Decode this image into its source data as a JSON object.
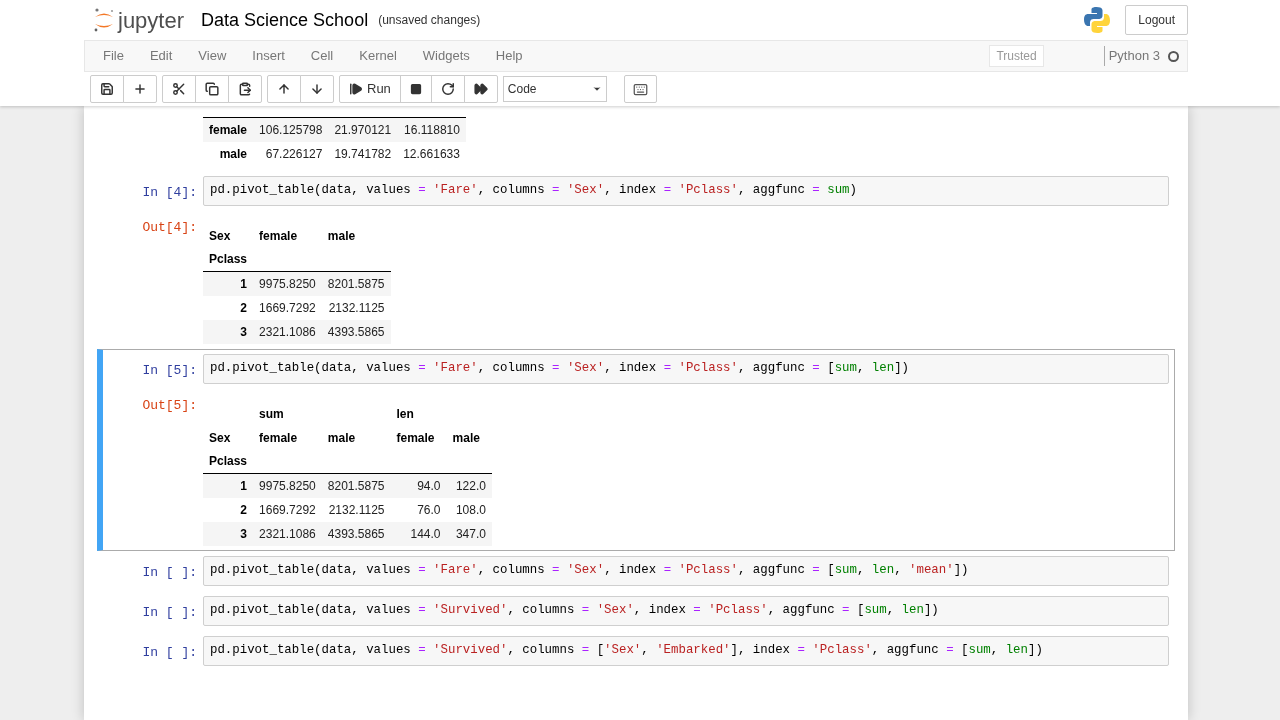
{
  "header": {
    "logo_text": "jupyter",
    "notebook_title": "Data Science School",
    "save_status": "(unsaved changes)",
    "logout": "Logout"
  },
  "menu": {
    "items": [
      "File",
      "Edit",
      "View",
      "Insert",
      "Cell",
      "Kernel",
      "Widgets",
      "Help"
    ],
    "trusted": "Trusted",
    "kernel": "Python 3"
  },
  "toolbar": {
    "groups": [
      [
        {
          "kind": "save"
        },
        {
          "kind": "add"
        }
      ],
      [
        {
          "kind": "cut"
        },
        {
          "kind": "copy"
        },
        {
          "kind": "paste"
        }
      ],
      [
        {
          "kind": "up"
        },
        {
          "kind": "down"
        }
      ],
      [
        {
          "kind": "run",
          "label": "Run"
        },
        {
          "kind": "stop"
        },
        {
          "kind": "restart"
        },
        {
          "kind": "fastforward"
        }
      ]
    ],
    "cell_type": "Code"
  },
  "cells": [
    {
      "selected": false,
      "output": {
        "table": {
          "rows": [
            {
              "index": "female",
              "values": [
                "106.125798",
                "21.970121",
                "16.118810"
              ]
            },
            {
              "index": "male",
              "values": [
                "67.226127",
                "19.741782",
                "12.661633"
              ]
            }
          ]
        }
      }
    },
    {
      "selected": false,
      "prompt_in": "In [4]:",
      "code": [
        {
          "kind": "plain",
          "text": "pd.pivot_table(data, values "
        },
        {
          "kind": "op",
          "text": "="
        },
        {
          "kind": "str",
          "text": " 'Fare'"
        },
        {
          "kind": "plain",
          "text": ", columns "
        },
        {
          "kind": "op",
          "text": "="
        },
        {
          "kind": "str",
          "text": " 'Sex'"
        },
        {
          "kind": "plain",
          "text": ", index "
        },
        {
          "kind": "op",
          "text": "="
        },
        {
          "kind": "str",
          "text": " 'Pclass'"
        },
        {
          "kind": "plain",
          "text": ", aggfunc "
        },
        {
          "kind": "op",
          "text": "="
        },
        {
          "kind": "builtin",
          "text": " sum"
        },
        {
          "kind": "plain",
          "text": ")"
        }
      ],
      "prompt_out": "Out[4]:",
      "output": {
        "table": {
          "header_rows": [
            [
              "Sex",
              "female",
              "male"
            ]
          ],
          "index_header": "Pclass",
          "rows": [
            {
              "index": "1",
              "values": [
                "9975.8250",
                "8201.5875"
              ]
            },
            {
              "index": "2",
              "values": [
                "1669.7292",
                "2132.1125"
              ]
            },
            {
              "index": "3",
              "values": [
                "2321.1086",
                "4393.5865"
              ]
            }
          ]
        }
      }
    },
    {
      "selected": true,
      "prompt_in": "In [5]:",
      "code": [
        {
          "kind": "plain",
          "text": "pd.pivot_table(data, values "
        },
        {
          "kind": "op",
          "text": "="
        },
        {
          "kind": "str",
          "text": " 'Fare'"
        },
        {
          "kind": "plain",
          "text": ", columns "
        },
        {
          "kind": "op",
          "text": "="
        },
        {
          "kind": "str",
          "text": " 'Sex'"
        },
        {
          "kind": "plain",
          "text": ", index "
        },
        {
          "kind": "op",
          "text": "="
        },
        {
          "kind": "str",
          "text": " 'Pclass'"
        },
        {
          "kind": "plain",
          "text": ", aggfunc "
        },
        {
          "kind": "op",
          "text": "="
        },
        {
          "kind": "plain",
          "text": " ["
        },
        {
          "kind": "builtin",
          "text": "sum"
        },
        {
          "kind": "plain",
          "text": ", "
        },
        {
          "kind": "builtin",
          "text": "len"
        },
        {
          "kind": "plain",
          "text": "])"
        }
      ],
      "prompt_out": "Out[5]:",
      "output": {
        "table": {
          "header_rows": [
            [
              null,
              "sum",
              null,
              "len",
              null
            ],
            [
              "Sex",
              "female",
              "male",
              "female",
              "male"
            ]
          ],
          "index_header": "Pclass",
          "rows": [
            {
              "index": "1",
              "values": [
                "9975.8250",
                "8201.5875",
                "94.0",
                "122.0"
              ]
            },
            {
              "index": "2",
              "values": [
                "1669.7292",
                "2132.1125",
                "76.0",
                "108.0"
              ]
            },
            {
              "index": "3",
              "values": [
                "2321.1086",
                "4393.5865",
                "144.0",
                "347.0"
              ]
            }
          ]
        }
      }
    },
    {
      "selected": false,
      "prompt_in": "In [ ]:",
      "code": [
        {
          "kind": "plain",
          "text": "pd.pivot_table(data, values "
        },
        {
          "kind": "op",
          "text": "="
        },
        {
          "kind": "str",
          "text": " 'Fare'"
        },
        {
          "kind": "plain",
          "text": ", columns "
        },
        {
          "kind": "op",
          "text": "="
        },
        {
          "kind": "str",
          "text": " 'Sex'"
        },
        {
          "kind": "plain",
          "text": ", index "
        },
        {
          "kind": "op",
          "text": "="
        },
        {
          "kind": "str",
          "text": " 'Pclass'"
        },
        {
          "kind": "plain",
          "text": ", aggfunc "
        },
        {
          "kind": "op",
          "text": "="
        },
        {
          "kind": "plain",
          "text": " ["
        },
        {
          "kind": "builtin",
          "text": "sum"
        },
        {
          "kind": "plain",
          "text": ", "
        },
        {
          "kind": "builtin",
          "text": "len"
        },
        {
          "kind": "plain",
          "text": ", "
        },
        {
          "kind": "str",
          "text": "'mean'"
        },
        {
          "kind": "plain",
          "text": "])"
        }
      ]
    },
    {
      "selected": false,
      "prompt_in": "In [ ]:",
      "code": [
        {
          "kind": "plain",
          "text": "pd.pivot_table(data, values "
        },
        {
          "kind": "op",
          "text": "="
        },
        {
          "kind": "str",
          "text": " 'Survived'"
        },
        {
          "kind": "plain",
          "text": ", columns "
        },
        {
          "kind": "op",
          "text": "="
        },
        {
          "kind": "str",
          "text": " 'Sex'"
        },
        {
          "kind": "plain",
          "text": ", index "
        },
        {
          "kind": "op",
          "text": "="
        },
        {
          "kind": "str",
          "text": " 'Pclass'"
        },
        {
          "kind": "plain",
          "text": ", aggfunc "
        },
        {
          "kind": "op",
          "text": "="
        },
        {
          "kind": "plain",
          "text": " ["
        },
        {
          "kind": "builtin",
          "text": "sum"
        },
        {
          "kind": "plain",
          "text": ", "
        },
        {
          "kind": "builtin",
          "text": "len"
        },
        {
          "kind": "plain",
          "text": "])"
        }
      ]
    },
    {
      "selected": false,
      "prompt_in": "In [ ]:",
      "code": [
        {
          "kind": "plain",
          "text": "pd.pivot_table(data, values "
        },
        {
          "kind": "op",
          "text": "="
        },
        {
          "kind": "str",
          "text": " 'Survived'"
        },
        {
          "kind": "plain",
          "text": ", columns "
        },
        {
          "kind": "op",
          "text": "="
        },
        {
          "kind": "plain",
          "text": " ["
        },
        {
          "kind": "str",
          "text": "'Sex'"
        },
        {
          "kind": "plain",
          "text": ", "
        },
        {
          "kind": "str",
          "text": "'Embarked'"
        },
        {
          "kind": "plain",
          "text": "], index "
        },
        {
          "kind": "op",
          "text": "="
        },
        {
          "kind": "str",
          "text": " 'Pclass'"
        },
        {
          "kind": "plain",
          "text": ", aggfunc "
        },
        {
          "kind": "op",
          "text": "="
        },
        {
          "kind": "plain",
          "text": " ["
        },
        {
          "kind": "builtin",
          "text": "sum"
        },
        {
          "kind": "plain",
          "text": ", "
        },
        {
          "kind": "builtin",
          "text": "len"
        },
        {
          "kind": "plain",
          "text": "])"
        }
      ]
    }
  ]
}
